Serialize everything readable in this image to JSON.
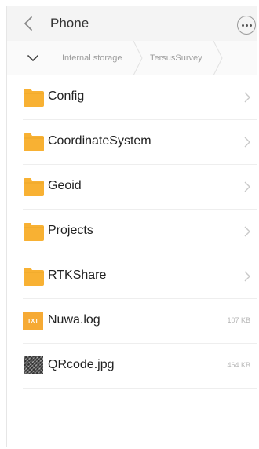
{
  "header": {
    "title": "Phone",
    "back_icon": "chevron-left-icon",
    "more_icon": "more-dots-icon"
  },
  "breadcrumb": {
    "toggle_icon": "chevron-down-icon",
    "items": [
      "Internal storage",
      "TersusSurvey"
    ]
  },
  "files": [
    {
      "name": "Config",
      "type": "folder",
      "icon": "folder-icon"
    },
    {
      "name": "CoordinateSystem",
      "type": "folder",
      "icon": "folder-icon"
    },
    {
      "name": "Geoid",
      "type": "folder",
      "icon": "folder-icon"
    },
    {
      "name": "Projects",
      "type": "folder",
      "icon": "folder-icon"
    },
    {
      "name": "RTKShare",
      "type": "folder",
      "icon": "folder-icon"
    },
    {
      "name": "Nuwa.log",
      "type": "file",
      "icon": "txt-file-icon",
      "badge": "TXT",
      "size": "107 KB"
    },
    {
      "name": "QRcode.jpg",
      "type": "file",
      "icon": "image-thumbnail-icon",
      "size": "464 KB"
    }
  ],
  "colors": {
    "folder": "#f8b133",
    "folder_dark": "#e99f1f",
    "txt_badge": "#f6aa34",
    "chevron": "#c8c8c8"
  }
}
